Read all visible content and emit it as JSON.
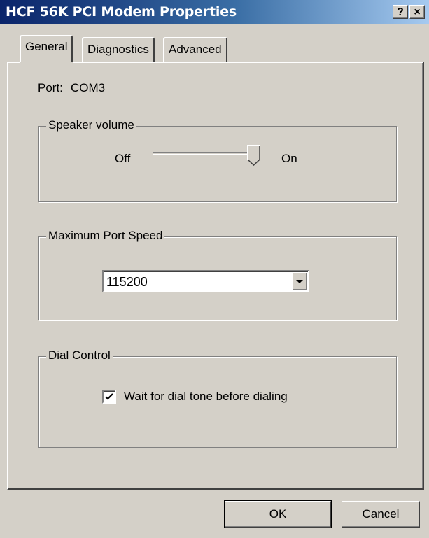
{
  "window": {
    "title": "HCF 56K PCI Modem Properties",
    "help_button": "?",
    "close_button": "×"
  },
  "tabs": [
    {
      "label": "General",
      "active": true
    },
    {
      "label": "Diagnostics",
      "active": false
    },
    {
      "label": "Advanced",
      "active": false
    }
  ],
  "general": {
    "port_label": "Port:",
    "port_value": "COM3",
    "speaker": {
      "title": "Speaker volume",
      "min_label": "Off",
      "max_label": "On",
      "level": 1.0
    },
    "port_speed": {
      "title": "Maximum Port Speed",
      "selected": "115200"
    },
    "dial": {
      "title": "Dial Control",
      "wait_label": "Wait for dial tone before dialing",
      "wait_checked": true
    }
  },
  "buttons": {
    "ok": "OK",
    "cancel": "Cancel"
  },
  "colors": {
    "face": "#d4d0c8",
    "title_start": "#0a246a",
    "title_end": "#a6caf0"
  }
}
